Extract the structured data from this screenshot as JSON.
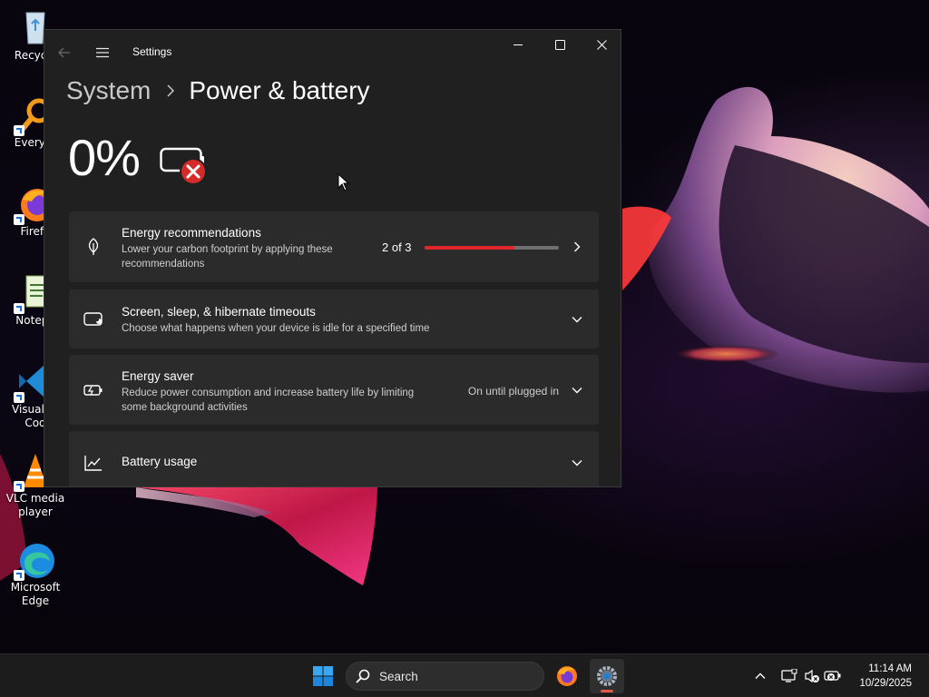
{
  "window": {
    "app_title": "Settings",
    "breadcrumb_parent": "System",
    "breadcrumb_current": "Power & battery",
    "battery_percent": "0%"
  },
  "cards": {
    "energy_recommendations": {
      "title": "Energy recommendations",
      "desc_line1": "Lower your carbon footprint by applying these",
      "desc_line2": "recommendations",
      "progress_text": "2 of 3",
      "progress_fraction": 0.667
    },
    "screen_sleep": {
      "title": "Screen, sleep, & hibernate timeouts",
      "desc_line1": "Choose what happens when your device is idle for a specified time"
    },
    "energy_saver": {
      "title": "Energy saver",
      "desc_line1": "Reduce power consumption and increase battery life by limiting",
      "desc_line2": "some background activities",
      "status": "On until plugged in"
    },
    "battery_usage": {
      "title": "Battery usage"
    }
  },
  "desktop_icons": [
    {
      "label_line1": "Recycle",
      "label_line2": ""
    },
    {
      "label_line1": "Everyth",
      "label_line2": ""
    },
    {
      "label_line1": "Firefo",
      "label_line2": ""
    },
    {
      "label_line1": "Notepa",
      "label_line2": ""
    },
    {
      "label_line1": "Visual St",
      "label_line2": "Cod"
    },
    {
      "label_line1": "VLC media",
      "label_line2": "player"
    },
    {
      "label_line1": "Microsoft",
      "label_line2": "Edge"
    }
  ],
  "taskbar": {
    "search_placeholder": "Search",
    "time": "11:14 AM",
    "date": "10/29/2025"
  },
  "colors": {
    "accent_progress": "#e0262b",
    "battery_error": "#d42a2a",
    "taskbar_indicator": "#e2594b"
  }
}
